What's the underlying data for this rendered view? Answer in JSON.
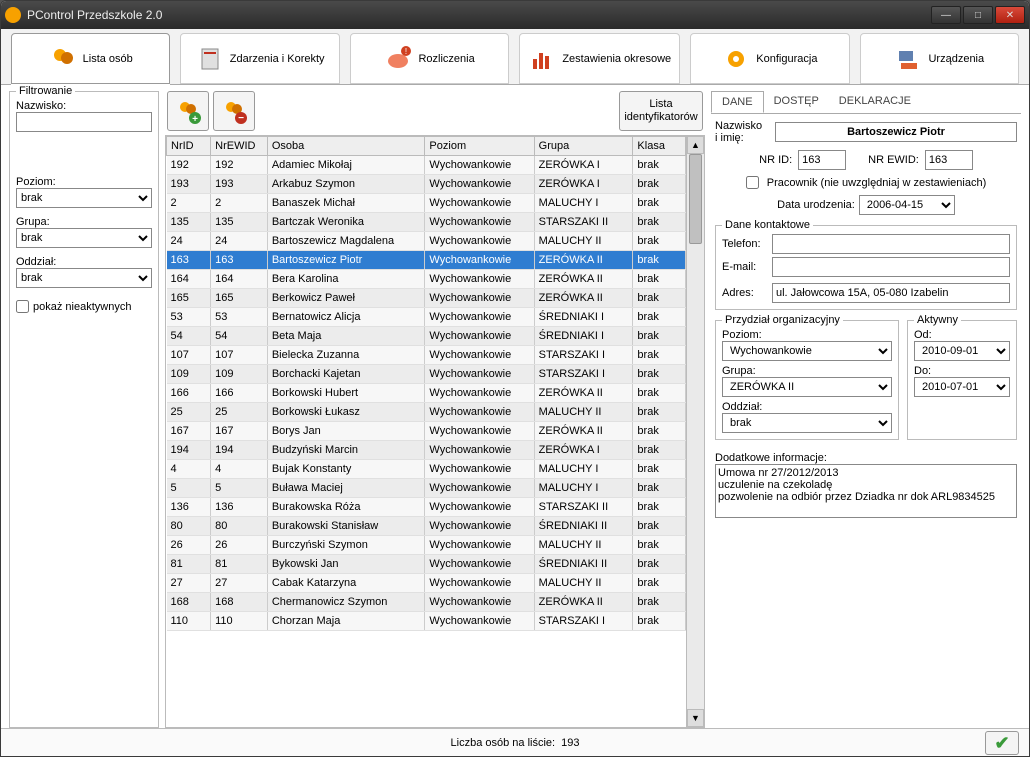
{
  "window": {
    "title": "PControl Przedszkole 2.0"
  },
  "toolbar": [
    {
      "label": "Lista osób",
      "icon": "people-icon",
      "active": true
    },
    {
      "label": "Zdarzenia i Korekty",
      "icon": "events-icon"
    },
    {
      "label": "Rozliczenia",
      "icon": "piggy-icon"
    },
    {
      "label": "Zestawienia okresowe",
      "icon": "chart-icon"
    },
    {
      "label": "Konfiguracja",
      "icon": "gear-icon"
    },
    {
      "label": "Urządzenia",
      "icon": "device-icon"
    }
  ],
  "filter": {
    "legend": "Filtrowanie",
    "lastname_label": "Nazwisko:",
    "lastname_value": "",
    "level_label": "Poziom:",
    "level_value": "brak",
    "group_label": "Grupa:",
    "group_value": "brak",
    "branch_label": "Oddział:",
    "branch_value": "brak",
    "show_inactive_label": "pokaż nieaktywnych",
    "show_inactive_checked": false
  },
  "listButtons": {
    "add": "add-person",
    "remove": "remove-person",
    "idlist": "Lista\nidentyfikatorów"
  },
  "columns": [
    "NrID",
    "NrEWID",
    "Osoba",
    "Poziom",
    "Grupa",
    "Klasa"
  ],
  "colWidths": [
    "42px",
    "54px",
    "150px",
    "104px",
    "94px",
    "50px"
  ],
  "rows": [
    {
      "nrid": "192",
      "nrewid": "192",
      "osoba": "Adamiec Mikołaj",
      "poziom": "Wychowankowie",
      "grupa": "ZERÓWKA I",
      "klasa": "brak"
    },
    {
      "nrid": "193",
      "nrewid": "193",
      "osoba": "Arkabuz Szymon",
      "poziom": "Wychowankowie",
      "grupa": "ZERÓWKA I",
      "klasa": "brak"
    },
    {
      "nrid": "2",
      "nrewid": "2",
      "osoba": "Banaszek Michał",
      "poziom": "Wychowankowie",
      "grupa": "MALUCHY I",
      "klasa": "brak"
    },
    {
      "nrid": "135",
      "nrewid": "135",
      "osoba": "Bartczak Weronika",
      "poziom": "Wychowankowie",
      "grupa": "STARSZAKI II",
      "klasa": "brak"
    },
    {
      "nrid": "24",
      "nrewid": "24",
      "osoba": "Bartoszewicz Magdalena",
      "poziom": "Wychowankowie",
      "grupa": "MALUCHY II",
      "klasa": "brak"
    },
    {
      "nrid": "163",
      "nrewid": "163",
      "osoba": "Bartoszewicz Piotr",
      "poziom": "Wychowankowie",
      "grupa": "ZERÓWKA II",
      "klasa": "brak",
      "selected": true
    },
    {
      "nrid": "164",
      "nrewid": "164",
      "osoba": "Bera Karolina",
      "poziom": "Wychowankowie",
      "grupa": "ZERÓWKA II",
      "klasa": "brak"
    },
    {
      "nrid": "165",
      "nrewid": "165",
      "osoba": "Berkowicz Paweł",
      "poziom": "Wychowankowie",
      "grupa": "ZERÓWKA II",
      "klasa": "brak"
    },
    {
      "nrid": "53",
      "nrewid": "53",
      "osoba": "Bernatowicz Alicja",
      "poziom": "Wychowankowie",
      "grupa": "ŚREDNIAKI I",
      "klasa": "brak"
    },
    {
      "nrid": "54",
      "nrewid": "54",
      "osoba": "Beta Maja",
      "poziom": "Wychowankowie",
      "grupa": "ŚREDNIAKI I",
      "klasa": "brak"
    },
    {
      "nrid": "107",
      "nrewid": "107",
      "osoba": "Bielecka Zuzanna",
      "poziom": "Wychowankowie",
      "grupa": "STARSZAKI I",
      "klasa": "brak"
    },
    {
      "nrid": "109",
      "nrewid": "109",
      "osoba": "Borchacki Kajetan",
      "poziom": "Wychowankowie",
      "grupa": "STARSZAKI I",
      "klasa": "brak"
    },
    {
      "nrid": "166",
      "nrewid": "166",
      "osoba": "Borkowski Hubert",
      "poziom": "Wychowankowie",
      "grupa": "ZERÓWKA II",
      "klasa": "brak"
    },
    {
      "nrid": "25",
      "nrewid": "25",
      "osoba": "Borkowski Łukasz",
      "poziom": "Wychowankowie",
      "grupa": "MALUCHY II",
      "klasa": "brak"
    },
    {
      "nrid": "167",
      "nrewid": "167",
      "osoba": "Borys Jan",
      "poziom": "Wychowankowie",
      "grupa": "ZERÓWKA II",
      "klasa": "brak"
    },
    {
      "nrid": "194",
      "nrewid": "194",
      "osoba": "Budzyński Marcin",
      "poziom": "Wychowankowie",
      "grupa": "ZERÓWKA I",
      "klasa": "brak"
    },
    {
      "nrid": "4",
      "nrewid": "4",
      "osoba": "Bujak Konstanty",
      "poziom": "Wychowankowie",
      "grupa": "MALUCHY I",
      "klasa": "brak"
    },
    {
      "nrid": "5",
      "nrewid": "5",
      "osoba": "Buława Maciej",
      "poziom": "Wychowankowie",
      "grupa": "MALUCHY I",
      "klasa": "brak"
    },
    {
      "nrid": "136",
      "nrewid": "136",
      "osoba": "Burakowska Róża",
      "poziom": "Wychowankowie",
      "grupa": "STARSZAKI II",
      "klasa": "brak"
    },
    {
      "nrid": "80",
      "nrewid": "80",
      "osoba": "Burakowski Stanisław",
      "poziom": "Wychowankowie",
      "grupa": "ŚREDNIAKI II",
      "klasa": "brak"
    },
    {
      "nrid": "26",
      "nrewid": "26",
      "osoba": "Burczyński Szymon",
      "poziom": "Wychowankowie",
      "grupa": "MALUCHY II",
      "klasa": "brak"
    },
    {
      "nrid": "81",
      "nrewid": "81",
      "osoba": "Bykowski Jan",
      "poziom": "Wychowankowie",
      "grupa": "ŚREDNIAKI II",
      "klasa": "brak"
    },
    {
      "nrid": "27",
      "nrewid": "27",
      "osoba": "Cabak Katarzyna",
      "poziom": "Wychowankowie",
      "grupa": "MALUCHY II",
      "klasa": "brak"
    },
    {
      "nrid": "168",
      "nrewid": "168",
      "osoba": "Chermanowicz Szymon",
      "poziom": "Wychowankowie",
      "grupa": "ZERÓWKA II",
      "klasa": "brak"
    },
    {
      "nrid": "110",
      "nrewid": "110",
      "osoba": "Chorzan Maja",
      "poziom": "Wychowankowie",
      "grupa": "STARSZAKI I",
      "klasa": "brak"
    }
  ],
  "status": {
    "label": "Liczba osób na liście:",
    "count": "193"
  },
  "detail": {
    "tabs": [
      "DANE",
      "DOSTĘP",
      "DEKLARACJE"
    ],
    "active_tab": 0,
    "name_label": "Nazwisko\ni imię:",
    "name_value": "Bartoszewicz Piotr",
    "nrid_label": "NR ID:",
    "nrid_value": "163",
    "nrewid_label": "NR EWID:",
    "nrewid_value": "163",
    "employee_label": "Pracownik (nie uwzględniaj w zestawieniach)",
    "employee_checked": false,
    "birth_label": "Data urodzenia:",
    "birth_value": "2006-04-15",
    "contact_legend": "Dane kontaktowe",
    "phone_label": "Telefon:",
    "phone_value": "",
    "email_label": "E-mail:",
    "email_value": "",
    "addr_label": "Adres:",
    "addr_value": "ul. Jałowcowa 15A, 05-080 Izabelin",
    "org_legend": "Przydział organizacyjny",
    "org_level_label": "Poziom:",
    "org_level_value": "Wychowankowie",
    "org_group_label": "Grupa:",
    "org_group_value": "ZERÓWKA II",
    "org_branch_label": "Oddział:",
    "org_branch_value": "brak",
    "active_legend": "Aktywny",
    "active_from_label": "Od:",
    "active_from_value": "2010-09-01",
    "active_to_label": "Do:",
    "active_to_value": "2010-07-01",
    "addinfo_label": "Dodatkowe informacje:",
    "addinfo_value": "Umowa nr 27/2012/2013\nuczulenie na czekoladę\npozwolenie na odbiór przez Dziadka nr dok ARL9834525"
  }
}
